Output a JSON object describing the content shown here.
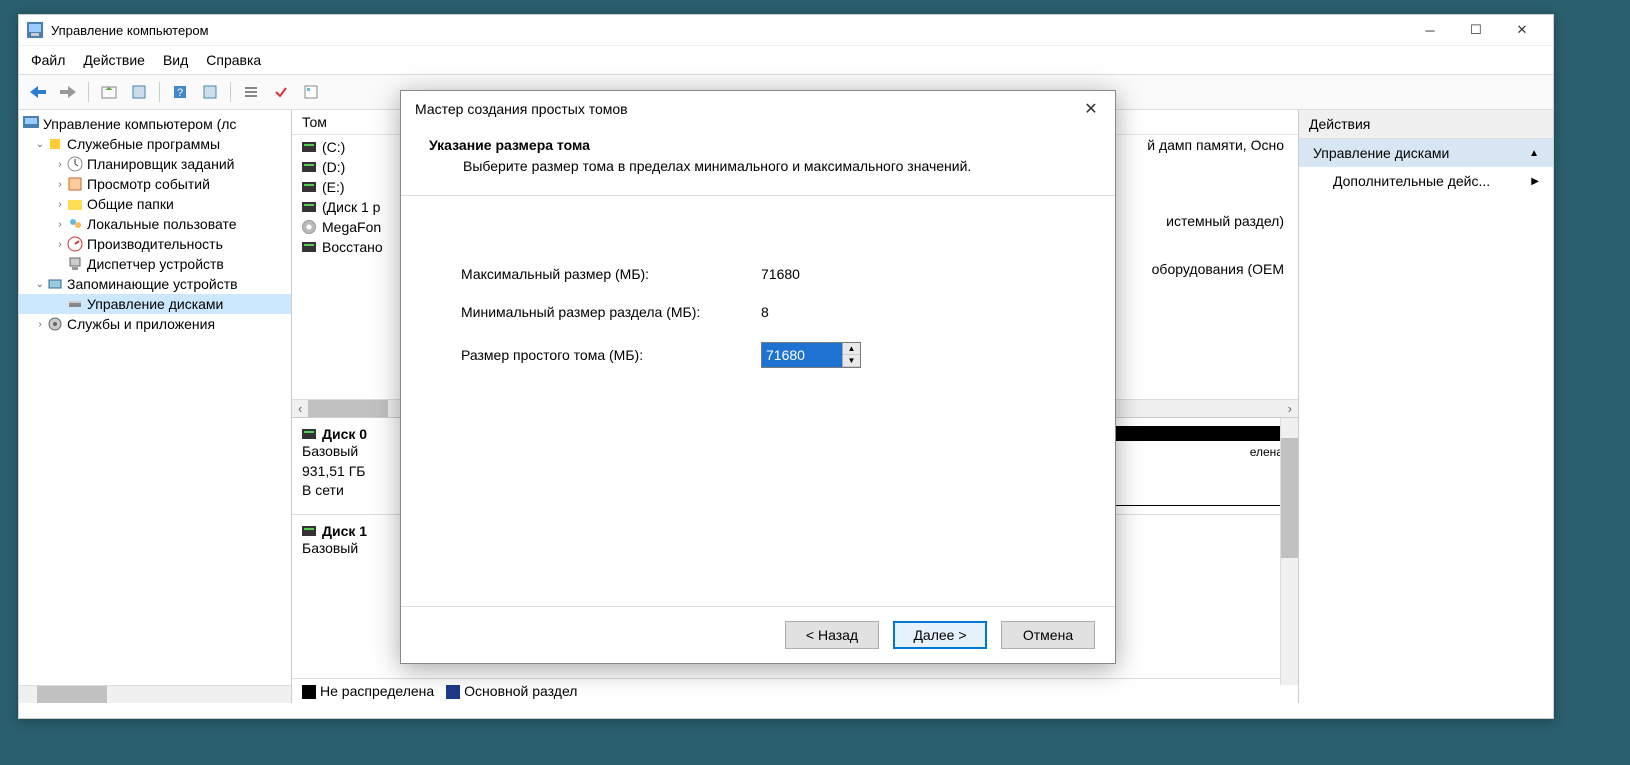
{
  "window": {
    "title": "Управление компьютером"
  },
  "menubar": {
    "file": "Файл",
    "action": "Действие",
    "view": "Вид",
    "help": "Справка"
  },
  "tree": {
    "root": "Управление компьютером (лс",
    "sys_tools": "Служебные программы",
    "scheduler": "Планировщик заданий",
    "eventviewer": "Просмотр событий",
    "shared": "Общие папки",
    "localusers": "Локальные пользовате",
    "perf": "Производительность",
    "devmgr": "Диспетчер устройств",
    "storage": "Запоминающие устройств",
    "diskmgmt": "Управление дисками",
    "services": "Службы и приложения"
  },
  "listhead": "Том",
  "volumes": {
    "c": "(C:)",
    "d": "(D:)",
    "e": "(E:)",
    "disk1p": "(Диск 1 р",
    "megafon": "MegaFon",
    "recovery": "Восстано"
  },
  "bg_texts": {
    "t1": "й дамп памяти, Осно",
    "t2": "истемный раздел)",
    "t3": "оборудования (OEM",
    "t4": "елена"
  },
  "disk0": {
    "name": "Диск 0",
    "type": "Базовый",
    "size": "931,51 ГБ",
    "status": "В сети"
  },
  "disk1": {
    "name": "Диск 1",
    "type": "Базовый"
  },
  "legend": {
    "unalloc": "Не распределена",
    "primary": "Основной раздел"
  },
  "actions": {
    "header": "Действия",
    "diskmgmt": "Управление дисками",
    "more": "Дополнительные дейс..."
  },
  "dialog": {
    "title": "Мастер создания простых томов",
    "heading": "Указание размера тома",
    "sub": "Выберите размер тома в пределах минимального и максимального значений.",
    "max_lbl": "Максимальный размер (МБ):",
    "max_val": "71680",
    "min_lbl": "Минимальный размер раздела (МБ):",
    "min_val": "8",
    "size_lbl": "Размер простого тома (МБ):",
    "size_val": "71680",
    "back": "< Назад",
    "next": "Далее >",
    "cancel": "Отмена"
  }
}
